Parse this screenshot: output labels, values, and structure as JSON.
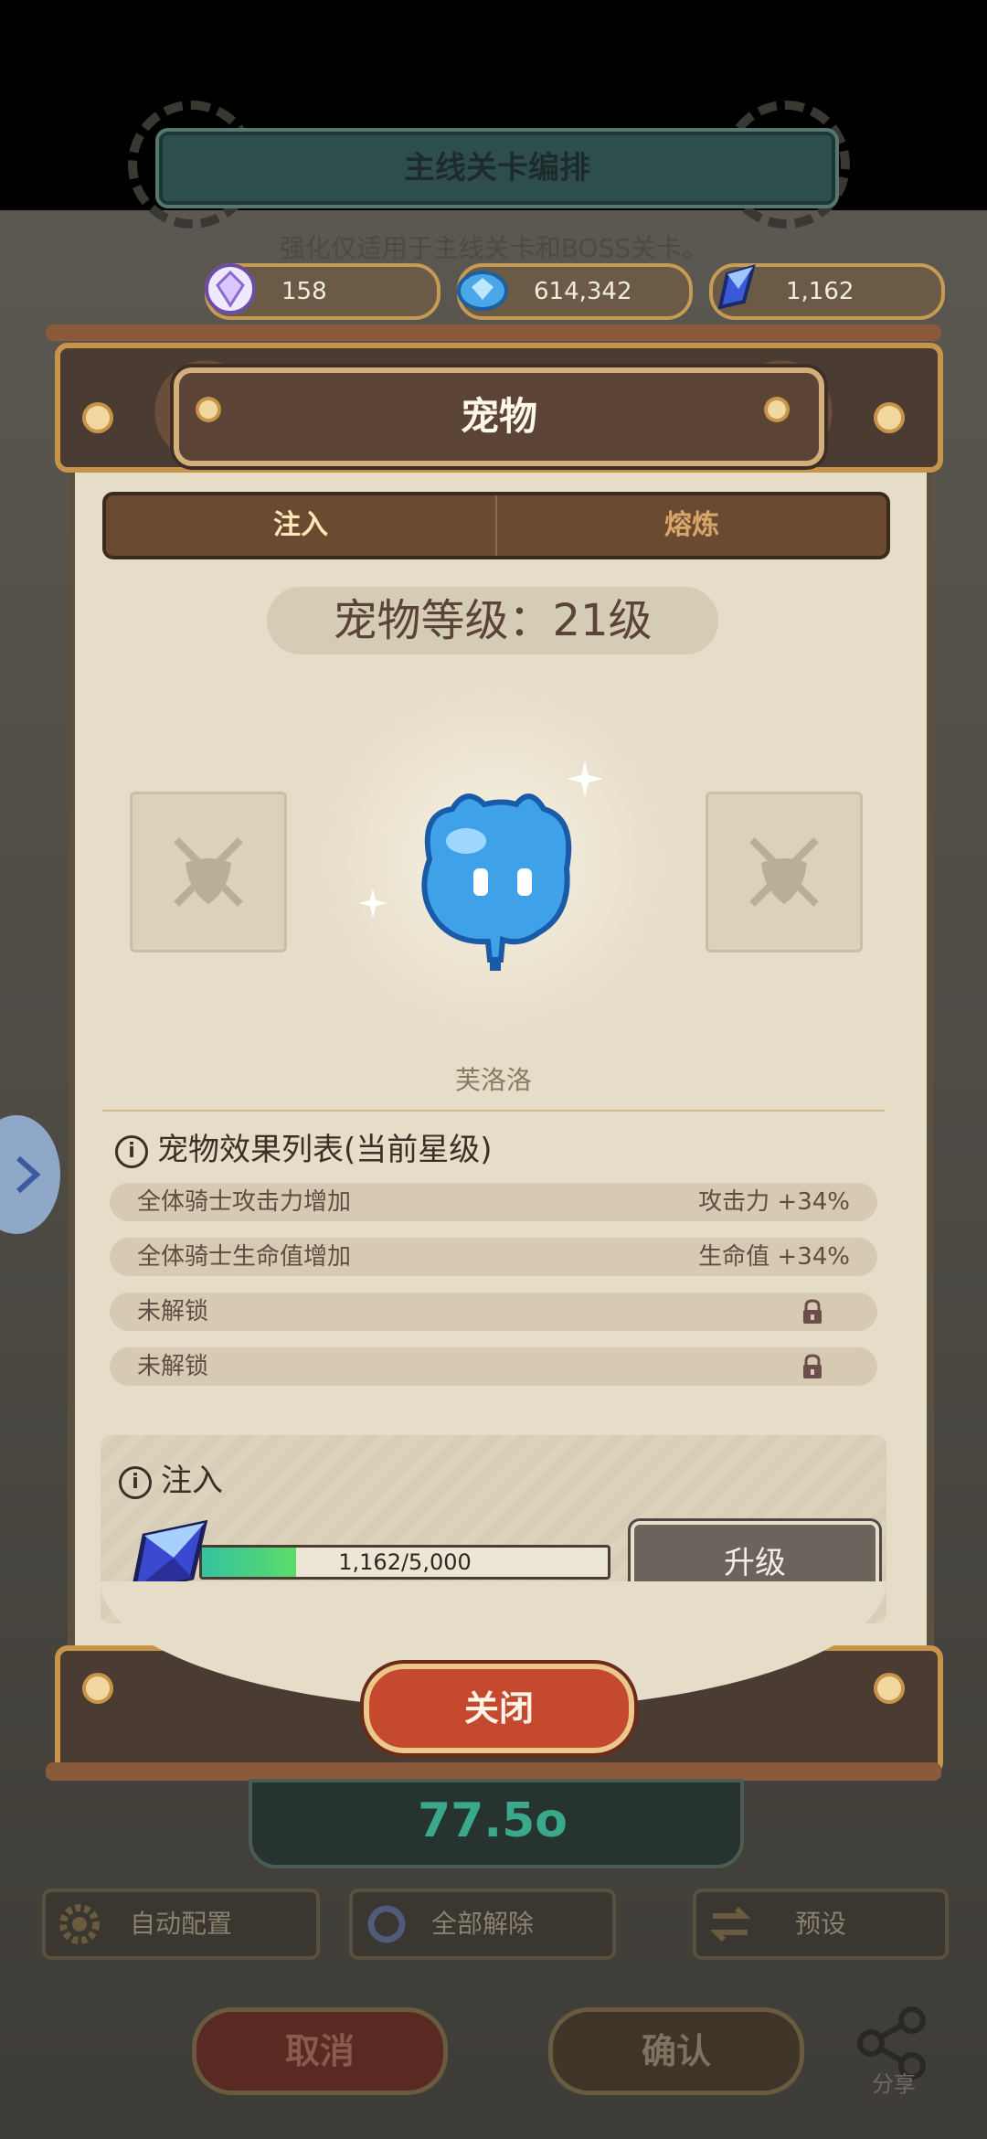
{
  "background": {
    "banner_title": "主线关卡编排",
    "subtitle": "强化仅适用于主线关卡和BOSS关卡。",
    "score": "77.5o",
    "buttons": {
      "auto_config": "自动配置",
      "release_all": "全部解除",
      "preset": "预设",
      "cancel": "取消",
      "confirm": "确认",
      "share": "分享"
    }
  },
  "currency": [
    {
      "icon": "diamond-gem-icon",
      "value": "158"
    },
    {
      "icon": "blue-gem-icon",
      "value": "614,342"
    },
    {
      "icon": "blue-crystal-icon",
      "value": "1,162"
    }
  ],
  "dialog": {
    "title": "宠物",
    "tabs": [
      {
        "label": "注入",
        "active": true
      },
      {
        "label": "熔炼",
        "active": false
      }
    ],
    "pet_level": "宠物等级：21级",
    "pet_name": "芙洛洛",
    "effects_title": "宠物效果列表(当前星级)",
    "effects": [
      {
        "label": "全体骑士攻击力增加",
        "value": "攻击力 +34%",
        "locked": false
      },
      {
        "label": "全体骑士生命值增加",
        "value": "生命值 +34%",
        "locked": false
      },
      {
        "label": "未解锁",
        "value": "",
        "locked": true
      },
      {
        "label": "未解锁",
        "value": "",
        "locked": true
      }
    ],
    "inject": {
      "title": "注入",
      "progress_text": "1,162/5,000",
      "progress_fraction": 0.2324,
      "upgrade_label": "升级"
    },
    "close_label": "关闭"
  },
  "colors": {
    "accent_gold": "#c8944a",
    "close_red": "#c5492e",
    "progress_green": "#4cd080"
  }
}
